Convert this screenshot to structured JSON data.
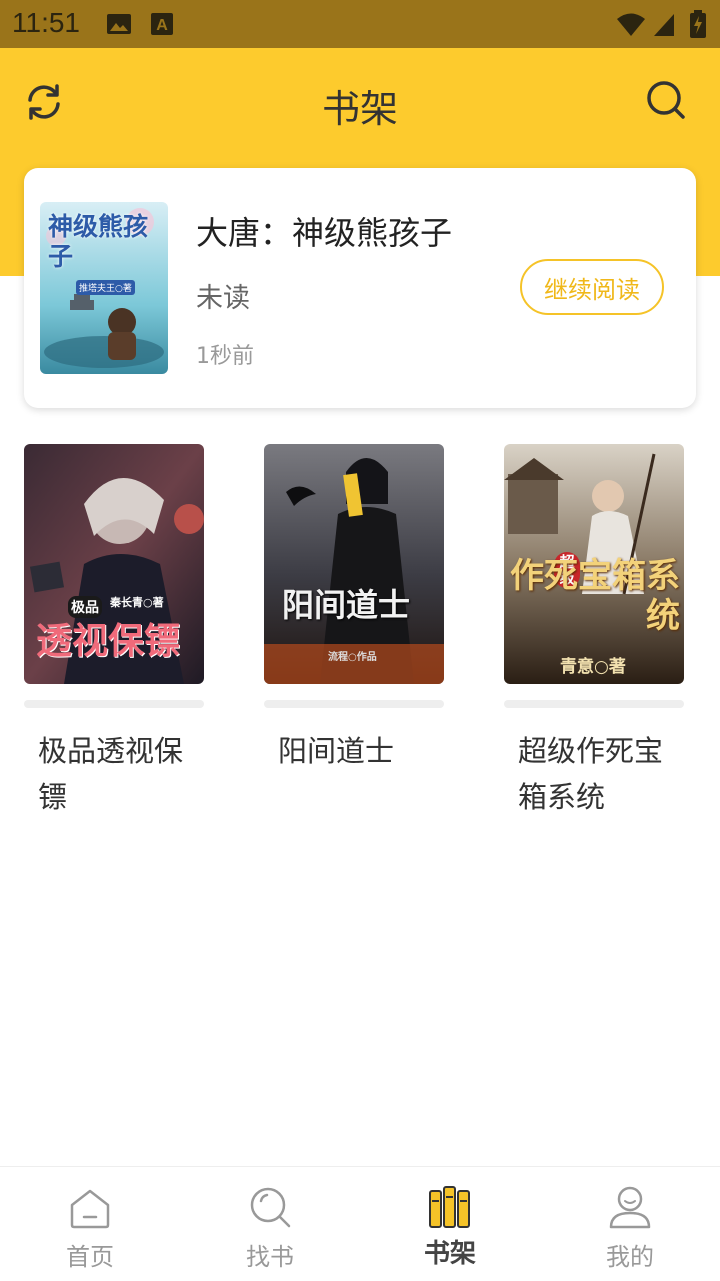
{
  "status_bar": {
    "time": "11:51"
  },
  "header": {
    "title": "书架"
  },
  "recent": {
    "title": "大唐：神级熊孩子",
    "status": "未读",
    "time_ago": "1秒前",
    "continue_label": "继续阅读",
    "cover_text": "神级熊孩子",
    "cover_author": "推塔夫王○著"
  },
  "books": [
    {
      "title": "极品透视保镖",
      "cover_text": "透视保镖",
      "cover_tag": "极品",
      "cover_author": "秦长青○著"
    },
    {
      "title": "阳间道士",
      "cover_text": "阳间道士",
      "cover_author": "流程○作品"
    },
    {
      "title": "超级作死宝箱系统",
      "cover_text": "作死宝箱系统",
      "cover_tag": "超级",
      "cover_author": "青意○著"
    }
  ],
  "nav": {
    "items": [
      {
        "label": "首页",
        "icon": "home-icon"
      },
      {
        "label": "找书",
        "icon": "search-icon"
      },
      {
        "label": "书架",
        "icon": "bookshelf-icon",
        "active": true
      },
      {
        "label": "我的",
        "icon": "profile-icon"
      }
    ]
  },
  "colors": {
    "accent": "#fdcb2d",
    "status_bar": "#9a741a",
    "button": "#f5c328"
  }
}
